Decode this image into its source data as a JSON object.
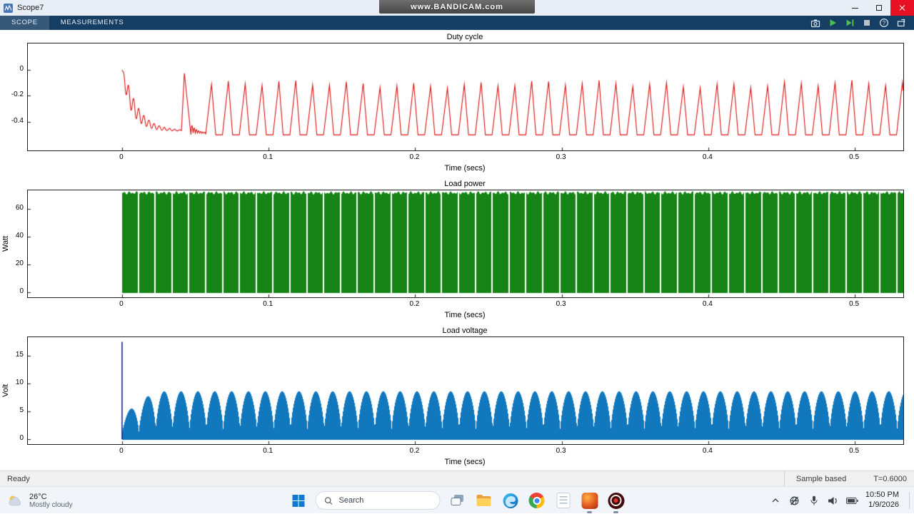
{
  "watermark": {
    "text": "www.BANDICAM.com"
  },
  "window": {
    "title": "Scope7"
  },
  "toolbar": {
    "tabs": [
      {
        "label": "SCOPE",
        "active": true
      },
      {
        "label": "MEASUREMENTS",
        "active": false
      }
    ],
    "icons": [
      "snapshot",
      "run",
      "step-forward",
      "stop",
      "help",
      "dock"
    ]
  },
  "status_bar": {
    "left": "Ready",
    "sample_mode": "Sample based",
    "time_value": "T=0.6000"
  },
  "taskbar": {
    "weather": {
      "temperature": "26°C",
      "condition": "Mostly cloudy"
    },
    "search": {
      "placeholder": "Search"
    },
    "apps": [
      "start",
      "search",
      "task-view",
      "file-explorer",
      "edge",
      "chrome",
      "notepad",
      "matlab",
      "bandicam"
    ],
    "open_apps": [
      "matlab",
      "bandicam"
    ],
    "tray": [
      "chevron-up",
      "no-internet",
      "microphone",
      "volume",
      "battery"
    ],
    "clock": {
      "time": "10:50 PM",
      "date": "1/9/2026"
    }
  },
  "chart_data": [
    {
      "type": "line",
      "title": "Duty cycle",
      "xlabel": "Time (secs)",
      "ylabel": "",
      "color": "#dd1111",
      "xlim": [
        -0.0643,
        0.5331
      ],
      "ylim": [
        -0.62,
        0.203
      ],
      "xticks": [
        0,
        0.1,
        0.2,
        0.3,
        0.4,
        0.5
      ],
      "yticks": [
        0,
        -0.2,
        -0.4
      ],
      "grid": false,
      "legend": false,
      "signal": {
        "kind": "duty-cycle-sawtooth",
        "start_time": 0,
        "initial_value": 0,
        "transient": {
          "settle": -0.47,
          "amp": 0.47,
          "tau": 0.0085,
          "ripple_amp": 0.13,
          "ripple_grow_tau": 0.003,
          "ripple_decay_tau": 0.012,
          "ripple_period": 0.0035,
          "end": 0.0405
        },
        "second_spike": {
          "time": 0.0425,
          "peak": -0.025,
          "fall_end": 0.047
        },
        "post_ripple": {
          "amp": 0.07,
          "decay_tau": 0.004,
          "period": 0.003
        },
        "steady": {
          "start": 0.057,
          "period": 0.0115,
          "base": -0.5,
          "peak": -0.11,
          "rise_frac": 0.35,
          "fall_frac": 0.25,
          "peak_var": 0.02
        }
      }
    },
    {
      "type": "area",
      "title": "Load power",
      "xlabel": "Time (secs)",
      "ylabel": "Watt",
      "color": "#168416",
      "xlim": [
        -0.0643,
        0.5331
      ],
      "ylim": [
        -3.6,
        73.3
      ],
      "xticks": [
        0,
        0.1,
        0.2,
        0.3,
        0.4,
        0.5
      ],
      "yticks": [
        0,
        20,
        40,
        60
      ],
      "grid": false,
      "legend": false,
      "signal": {
        "kind": "chopped-constant",
        "start_time": 0,
        "level": 71.5,
        "level_ripple": 1.2,
        "period": 0.0115,
        "gap_frac": 0.085
      }
    },
    {
      "type": "area",
      "title": "Load voltage",
      "xlabel": "Time (secs)",
      "ylabel": "Volt",
      "color": "#1278be",
      "xlim": [
        -0.0643,
        0.5331
      ],
      "ylim": [
        -0.9,
        18.33
      ],
      "xticks": [
        0,
        0.1,
        0.2,
        0.3,
        0.4,
        0.5
      ],
      "yticks": [
        0,
        5,
        10,
        15
      ],
      "grid": false,
      "legend": false,
      "signal": {
        "kind": "scalloped-envelope",
        "start_time": 0,
        "initial_spike": 17.5,
        "spike_color": "#001b8e",
        "period": 0.0115,
        "env_min": 1.6,
        "env_max": 8.6,
        "exponent": 0.7,
        "ramp_time": 0.022
      }
    }
  ]
}
